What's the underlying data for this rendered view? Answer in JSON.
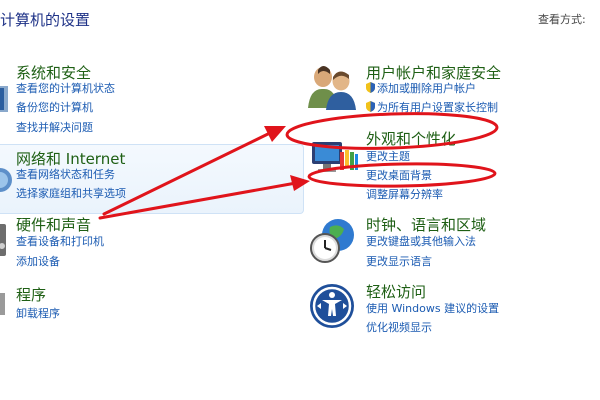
{
  "header": {
    "title": "计算机的设置",
    "view_by": "查看方式:"
  },
  "left_categories": [
    {
      "title": "系统和安全",
      "links": [
        "查看您的计算机状态",
        "备份您的计算机",
        "查找并解决问题"
      ]
    },
    {
      "title": "网络和 Internet",
      "links": [
        "查看网络状态和任务",
        "选择家庭组和共享选项"
      ]
    },
    {
      "title": "硬件和声音",
      "links": [
        "查看设备和打印机",
        "添加设备"
      ]
    },
    {
      "title": "程序",
      "links": [
        "卸载程序"
      ]
    }
  ],
  "right_categories": [
    {
      "title": "用户帐户和家庭安全",
      "links": [
        "添加或删除用户帐户",
        "为所有用户设置家长控制"
      ]
    },
    {
      "title": "外观和个性化",
      "links": [
        "更改主题",
        "更改桌面背景",
        "调整屏幕分辨率"
      ]
    },
    {
      "title": "时钟、语言和区域",
      "links": [
        "更改键盘或其他输入法",
        "更改显示语言"
      ]
    },
    {
      "title": "轻松访问",
      "links": [
        "使用 Windows 建议的设置",
        "优化视频显示"
      ]
    }
  ],
  "icons": {
    "system_security": "shield-icon",
    "network": "globe-network-icon",
    "hardware": "speaker-printer-icon",
    "programs": "programs-icon",
    "users": "users-icon",
    "appearance": "monitor-paint-icon",
    "clock": "clock-globe-icon",
    "ease_of_access": "ease-of-access-icon",
    "uac_shield": "uac-shield-icon"
  },
  "colors": {
    "category_title": "#1e5f14",
    "link": "#1b5bb2",
    "annotation": "#e0141b",
    "highlight_bg": "#eaf3fc"
  }
}
